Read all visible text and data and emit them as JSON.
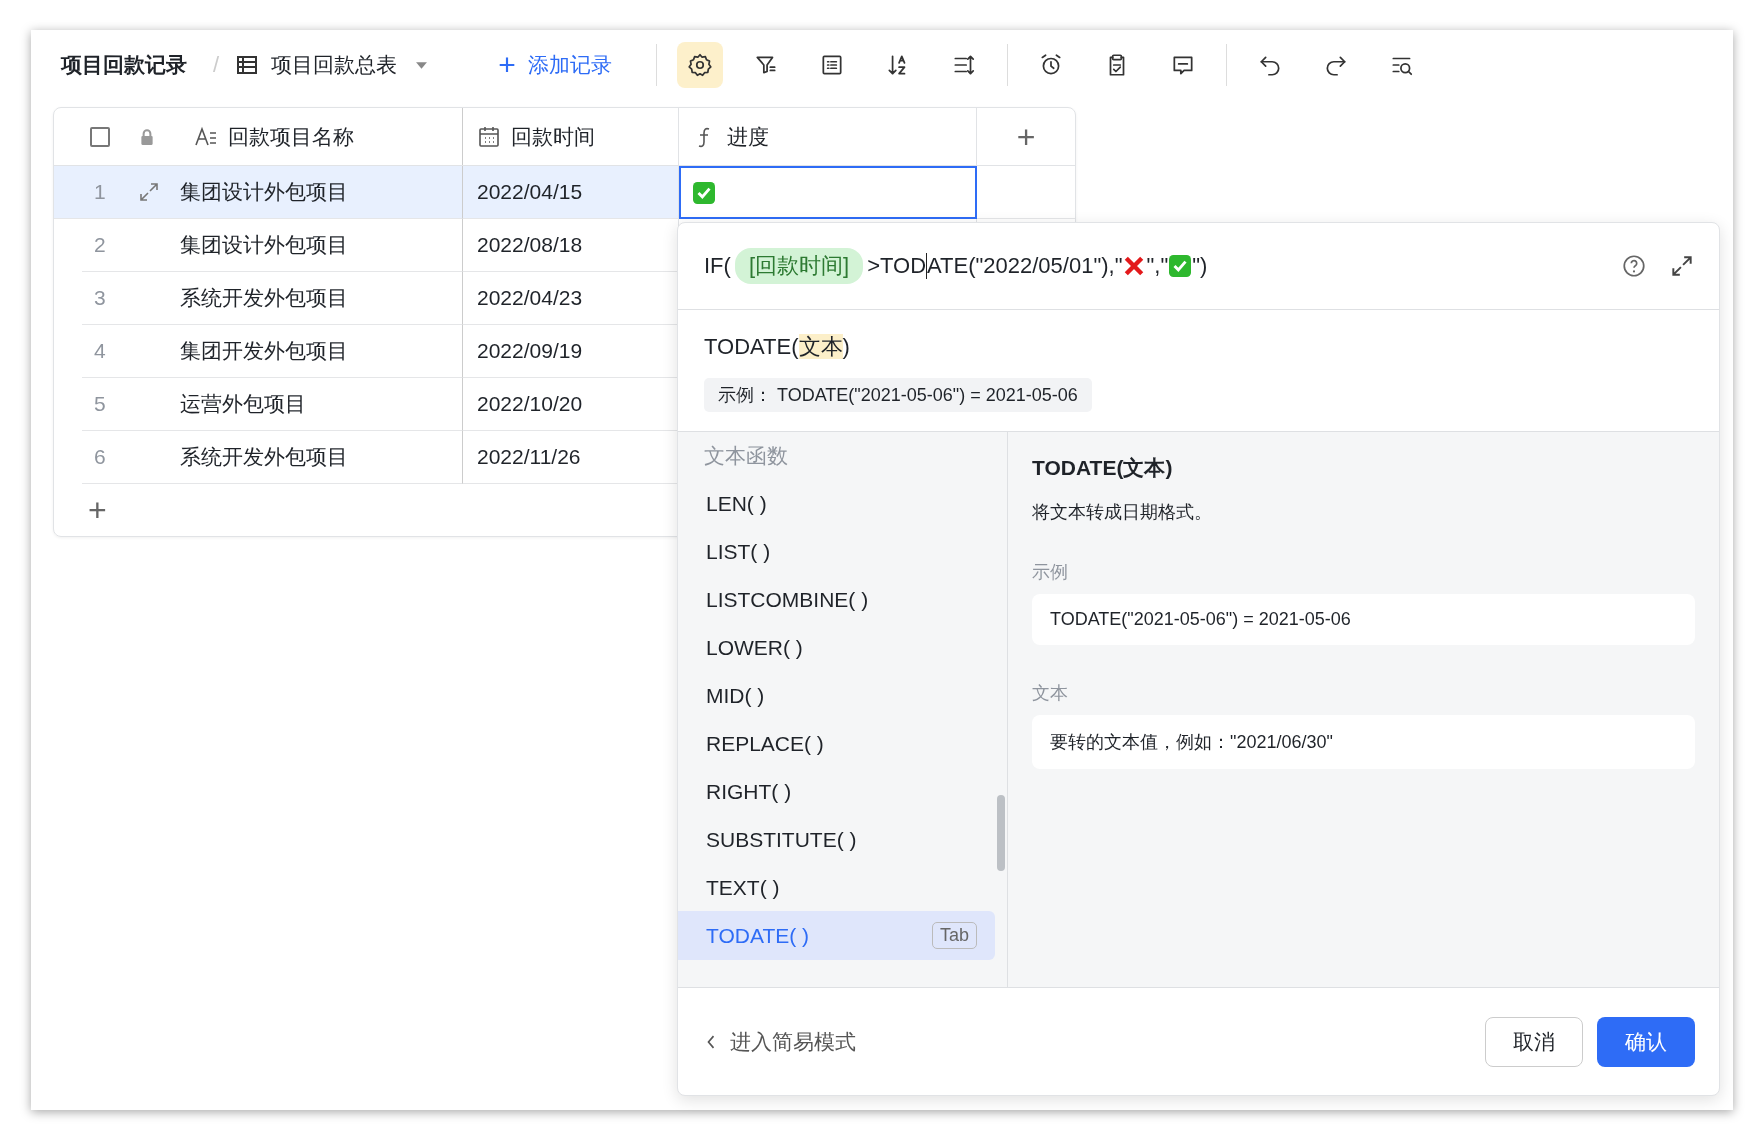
{
  "toolbar": {
    "title": "项目回款记录",
    "separator": "/",
    "view": {
      "label": "项目回款总表"
    },
    "add_button": {
      "icon": "+",
      "label": "添加记录"
    },
    "tools": [
      {
        "selected": true
      },
      {
        "selected": false
      },
      {
        "selected": false
      },
      {
        "selected": false
      },
      {
        "selected": false
      },
      {
        "selected": false
      },
      {
        "selected": false
      },
      {
        "selected": false
      },
      {
        "selected": false
      },
      {
        "selected": false
      },
      {
        "selected": false
      }
    ]
  },
  "table": {
    "select_all": {
      "checked": false
    },
    "columns": [
      {
        "label": "回款项目名称",
        "kind": "text"
      },
      {
        "label": "回款时间",
        "kind": "date"
      },
      {
        "label": "进度",
        "kind": "formula"
      }
    ],
    "add_column": "+",
    "rows": [
      {
        "index": "1",
        "name": "集团设计外包项目",
        "date": "2022/04/15",
        "progress": {
          "kind": "check"
        },
        "selected": true
      },
      {
        "index": "2",
        "name": "集团设计外包项目",
        "date": "2022/08/18",
        "selected": false
      },
      {
        "index": "3",
        "name": "系统开发外包项目",
        "date": "2022/04/23",
        "selected": false
      },
      {
        "index": "4",
        "name": "集团开发外包项目",
        "date": "2022/09/19",
        "selected": false
      },
      {
        "index": "5",
        "name": "运营外包项目",
        "date": "2022/10/20",
        "selected": false
      },
      {
        "index": "6",
        "name": "系统开发外包项目",
        "date": "2022/11/26",
        "selected": false
      }
    ],
    "add_row": "+"
  },
  "formula_editor": {
    "formula": [
      {
        "kind": "text",
        "text": "IF("
      },
      {
        "kind": "field",
        "text": "[回款时间]"
      },
      {
        "kind": "text",
        "text": ">TOD"
      },
      {
        "kind": "cursor"
      },
      {
        "kind": "text",
        "text": "ATE(\"2022/05/01\"),\""
      },
      {
        "kind": "cross"
      },
      {
        "kind": "text",
        "text": "\",\""
      },
      {
        "kind": "check"
      },
      {
        "kind": "text",
        "text": "\")"
      }
    ],
    "signature": {
      "name": "TODATE(",
      "param": "文本",
      "close": ")"
    },
    "example_chip": {
      "label": "示例：",
      "code": "TODATE(\"2021-05-06\") = 2021-05-06"
    },
    "function_list": {
      "category": "文本函数",
      "items": [
        {
          "label": "LEN( )",
          "selected": false
        },
        {
          "label": "LIST( )",
          "selected": false
        },
        {
          "label": "LISTCOMBINE( )",
          "selected": false
        },
        {
          "label": "LOWER( )",
          "selected": false
        },
        {
          "label": "MID( )",
          "selected": false
        },
        {
          "label": "REPLACE( )",
          "selected": false
        },
        {
          "label": "RIGHT( )",
          "selected": false
        },
        {
          "label": "SUBSTITUTE( )",
          "selected": false
        },
        {
          "label": "TEXT( )",
          "selected": false
        },
        {
          "label": "TODATE( )",
          "selected": true,
          "key_hint": "Tab"
        }
      ]
    },
    "detail": {
      "title": "TODATE(文本)",
      "description": "将文本转成日期格式。",
      "example_label": "示例",
      "example": "TODATE(\"2021-05-06\") = 2021-05-06",
      "param_label": "文本",
      "param_text": "要转的文本值，例如：\"2021/06/30\""
    },
    "simple_mode_link": "进入简易模式",
    "buttons": {
      "cancel": "取消",
      "confirm": "确认"
    }
  }
}
